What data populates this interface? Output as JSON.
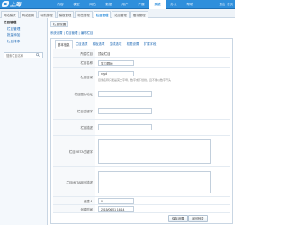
{
  "app": {
    "logo_text": "上海"
  },
  "top_nav": {
    "items": [
      {
        "label": "内容"
      },
      {
        "label": "模型"
      },
      {
        "label": "网站"
      },
      {
        "label": "数据"
      },
      {
        "label": "用户"
      },
      {
        "label": "扩展"
      },
      {
        "label": "系统",
        "active": true
      },
      {
        "label": "办公"
      },
      {
        "label": "帮助"
      }
    ],
    "right_links": [
      "退出",
      "首页"
    ]
  },
  "sub_tabs": [
    {
      "label": "网站模块"
    },
    {
      "label": "网站配置"
    },
    {
      "label": "导航管理"
    },
    {
      "label": "模板管理"
    },
    {
      "label": "标签管理"
    },
    {
      "label": "栏目管理",
      "active": true
    },
    {
      "label": "站点管理"
    },
    {
      "label": "缓存管理"
    }
  ],
  "sidebar": {
    "group_title": "栏目管理",
    "items": [
      {
        "label": "栏目管理"
      },
      {
        "label": "批量添加"
      },
      {
        "label": "栏目排序"
      }
    ],
    "search_placeholder": "搜索栏目名称"
  },
  "main": {
    "module_title": "栏目设置",
    "breadcrumb": "系统设置 | 栏目管理 | 编辑栏目",
    "panel_tabs": [
      {
        "label": "基本信息",
        "active": true
      },
      {
        "label": "栏目选项"
      },
      {
        "label": "模板选项"
      },
      {
        "label": "生成选项"
      },
      {
        "label": "权限设置"
      },
      {
        "label": "扩展字段"
      }
    ],
    "form": {
      "parent": {
        "label": "所属栏目",
        "value": "顶级栏目"
      },
      "name": {
        "label": "栏目名称",
        "value": "学习园地"
      },
      "dir": {
        "label": "栏目目录",
        "value": "xxyd",
        "hint": "目录名称只能是英文字母、数字或下划线，且不能以数字开头"
      },
      "image": {
        "label": "栏目图片地址",
        "value": ""
      },
      "keywords": {
        "label": "栏目关键字",
        "value": ""
      },
      "description": {
        "label": "栏目描述",
        "value": ""
      },
      "meta_keywords": {
        "label": "栏目META关键字",
        "value": ""
      },
      "meta_description": {
        "label": "栏目META网页描述",
        "value": ""
      },
      "creator": {
        "label": "创建人",
        "value": "0"
      },
      "created_at": {
        "label": "创建时间",
        "value": "2015/06/01 16:14"
      }
    },
    "buttons": {
      "save": "保存设置",
      "back": "返回列表"
    }
  },
  "colors": {
    "topbar": "#2f8fdc",
    "link": "#1a66b3",
    "border": "#c9d6e3"
  }
}
